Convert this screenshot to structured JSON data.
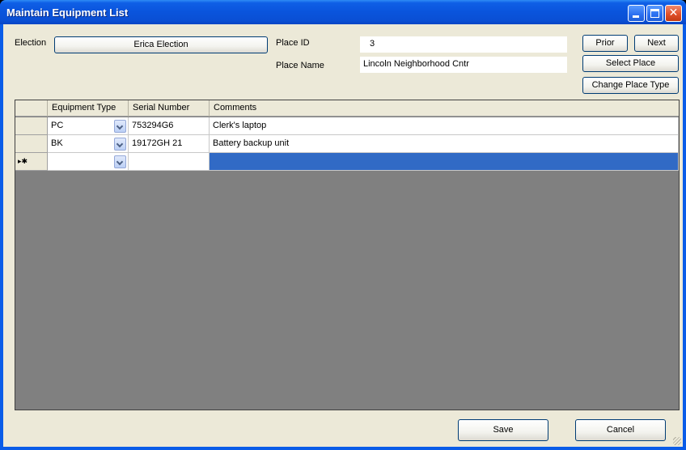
{
  "window": {
    "title": "Maintain Equipment List"
  },
  "header": {
    "election_label": "Election",
    "election_button": "Erica Election",
    "place_id_label": "Place ID",
    "place_id_value": "3",
    "place_name_label": "Place Name",
    "place_name_value": "Lincoln Neighborhood Cntr"
  },
  "nav": {
    "prior": "Prior",
    "next": "Next",
    "select_place": "Select Place",
    "change_place_type": "Change Place Type"
  },
  "grid": {
    "columns": [
      "Equipment Type",
      "Serial Number",
      "Comments"
    ],
    "rows": [
      {
        "type": "PC",
        "serial": "753294G6",
        "comments": "Clerk's laptop"
      },
      {
        "type": "BK",
        "serial": "19172GH 21",
        "comments": "Battery backup unit"
      }
    ],
    "new_row_marker": "▸✱",
    "selection_color": "#316ac5"
  },
  "footer": {
    "save": "Save",
    "cancel": "Cancel"
  }
}
